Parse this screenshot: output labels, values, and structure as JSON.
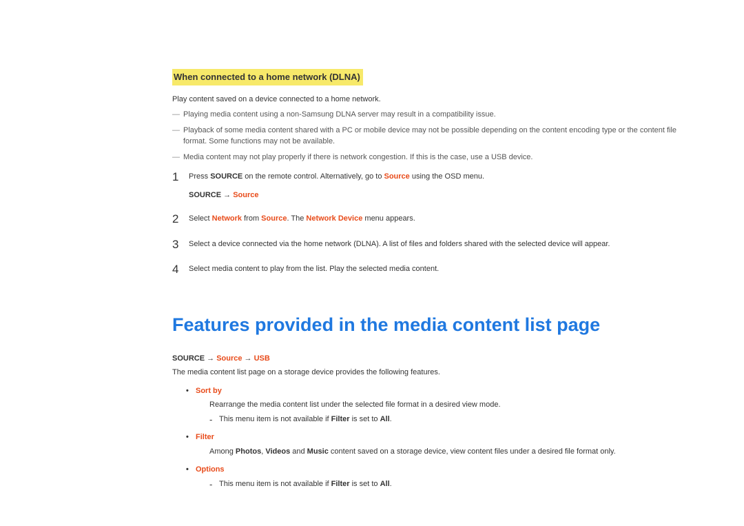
{
  "dlna": {
    "title": "When connected to a home network (DLNA)",
    "intro": "Play content saved on a device connected to a home network.",
    "notes": [
      "Playing media content using a non-Samsung DLNA server may result in a compatibility issue.",
      "Playback of some media content shared with a PC or mobile device may not be possible depending on the content encoding type or the content file format. Some functions may not be available.",
      "Media content may not play properly if there is network congestion. If this is the case, use a USB device."
    ],
    "steps": {
      "s1_a": "Press ",
      "s1_b": "SOURCE",
      "s1_c": " on the remote control. Alternatively, go to ",
      "s1_d": "Source",
      "s1_e": " using the OSD menu.",
      "s1_path_a": "SOURCE",
      "s1_path_arrow": " → ",
      "s1_path_b": "Source",
      "s2_a": "Select ",
      "s2_b": "Network",
      "s2_c": " from ",
      "s2_d": "Source",
      "s2_e": ". The ",
      "s2_f": "Network Device",
      "s2_g": " menu appears.",
      "s3": "Select a device connected via the home network (DLNA). A list of files and folders shared with the selected device will appear.",
      "s4": "Select media content to play from the list. Play the selected media content."
    },
    "num1": "1",
    "num2": "2",
    "num3": "3",
    "num4": "4"
  },
  "features": {
    "title": "Features provided in the media content list page",
    "path_a": "SOURCE",
    "path_arrow1": " → ",
    "path_b": "Source",
    "path_arrow2": " → ",
    "path_c": "USB",
    "intro": "The media content list page on a storage device provides the following features.",
    "sortby": {
      "label": "Sort by",
      "desc": "Rearrange the media content list under the selected file format in a desired view mode.",
      "note_a": "This menu item is not available if ",
      "note_b": "Filter",
      "note_c": " is set to ",
      "note_d": "All",
      "note_e": "."
    },
    "filter": {
      "label": "Filter",
      "desc_a": "Among ",
      "desc_b": "Photos",
      "desc_c": ", ",
      "desc_d": "Videos",
      "desc_e": " and ",
      "desc_f": "Music",
      "desc_g": " content saved on a storage device, view content files under a desired file format only."
    },
    "options": {
      "label": "Options",
      "note_a": "This menu item is not available if ",
      "note_b": "Filter",
      "note_c": " is set to ",
      "note_d": "All",
      "note_e": "."
    }
  }
}
